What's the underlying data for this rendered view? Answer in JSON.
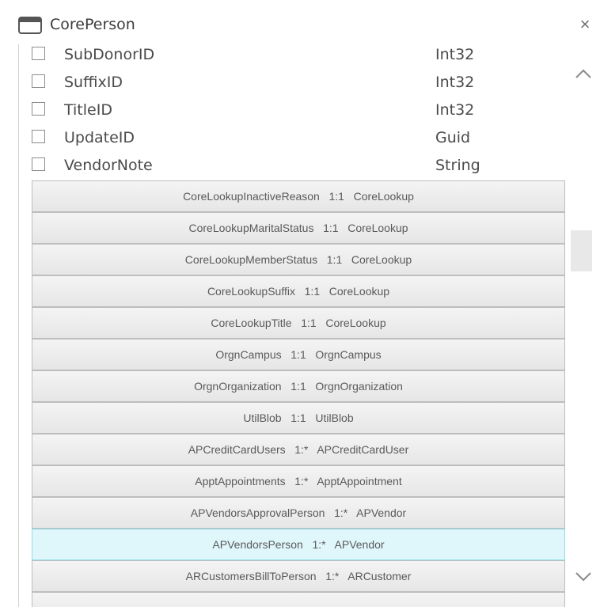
{
  "window": {
    "title": "CorePerson",
    "close_glyph": "×",
    "icon": "window-icon"
  },
  "fields": [
    {
      "name": "SubDonorID",
      "type": "Int32",
      "checked": false
    },
    {
      "name": "SuffixID",
      "type": "Int32",
      "checked": false
    },
    {
      "name": "TitleID",
      "type": "Int32",
      "checked": false
    },
    {
      "name": "UpdateID",
      "type": "Guid",
      "checked": false
    },
    {
      "name": "VendorNote",
      "type": "String",
      "checked": false
    }
  ],
  "relations": [
    {
      "label": "CoreLookupInactiveReason   1:1   CoreLookup"
    },
    {
      "label": "CoreLookupMaritalStatus   1:1   CoreLookup"
    },
    {
      "label": "CoreLookupMemberStatus   1:1   CoreLookup"
    },
    {
      "label": "CoreLookupSuffix   1:1   CoreLookup"
    },
    {
      "label": "CoreLookupTitle   1:1   CoreLookup"
    },
    {
      "label": "OrgnCampus   1:1   OrgnCampus"
    },
    {
      "label": "OrgnOrganization   1:1   OrgnOrganization"
    },
    {
      "label": "UtilBlob   1:1   UtilBlob"
    },
    {
      "label": "APCreditCardUsers   1:*   APCreditCardUser"
    },
    {
      "label": "ApptAppointments   1:*   ApptAppointment"
    },
    {
      "label": "APVendorsApprovalPerson   1:*   APVendor"
    },
    {
      "label": "APVendorsPerson   1:*   APVendor",
      "selected": true
    },
    {
      "label": "ARCustomersBillToPerson   1:*   ARCustomer"
    },
    {
      "label": ""
    }
  ],
  "scrollbar": {
    "up_icon": "chevron-up-icon",
    "down_icon": "chevron-down-icon"
  },
  "colors": {
    "selected_bg": "#dff7fb",
    "selected_border": "#8fdcea"
  }
}
